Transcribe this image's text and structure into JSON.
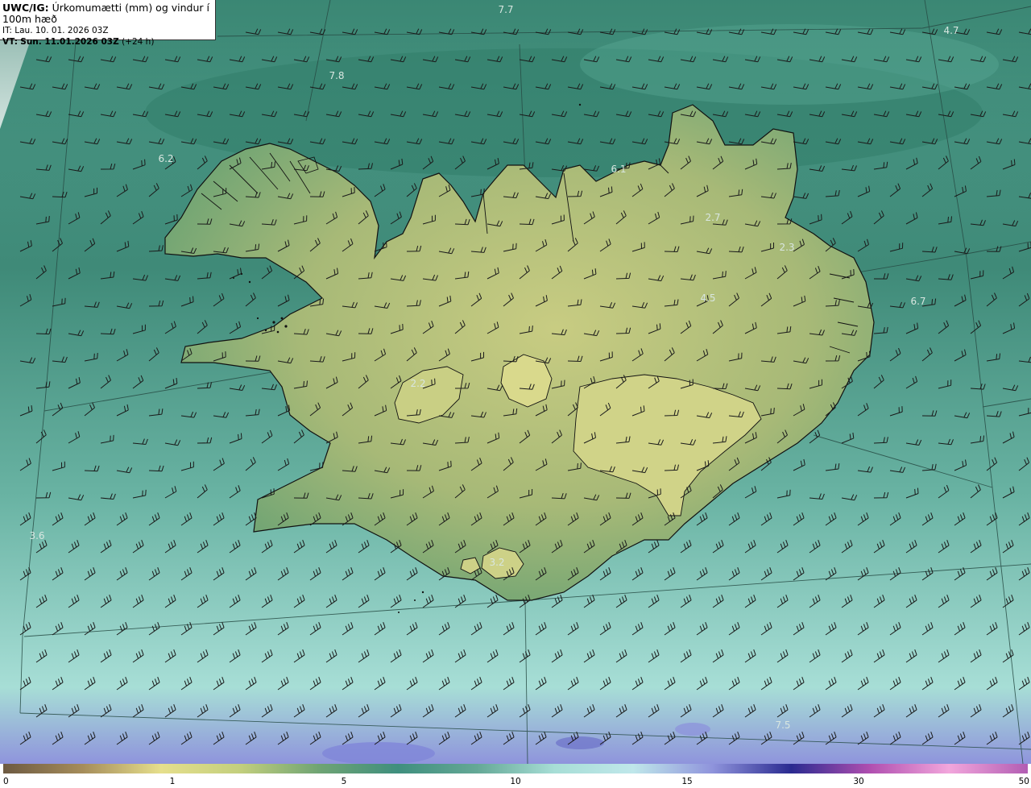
{
  "header": {
    "model": "UWC/IG:",
    "title": "Úrkomumætti (mm) og vindur í 100m hæð",
    "init_prefix": "IT:",
    "init_time": "Lau. 10. 01. 2026 03Z",
    "valid_prefix": "VT:",
    "valid_time": "Sun. 11.01.2026 03Z",
    "lead": "(+24 h)"
  },
  "colorbar": {
    "ticks": [
      "0",
      "1",
      "5",
      "10",
      "15",
      "30",
      "50"
    ],
    "colors": [
      "#6d5a42",
      "#a58c5a",
      "#e6df8c",
      "#c3cf7d",
      "#6fa474",
      "#3f8f7e",
      "#64a896",
      "#a7ded6",
      "#bfe7ea",
      "#8f94dc",
      "#2a2a90",
      "#b04fb0",
      "#f2a6dc",
      "#b25db3"
    ]
  },
  "map_values": [
    "7.7",
    "4.7",
    "7.8",
    "6.2",
    "6.1",
    "2.7",
    "2.3",
    "4.5",
    "6.7",
    "2.2",
    "3.6",
    "3.2",
    "7.5"
  ],
  "palette": {
    "sea": "#58a894",
    "land": "#d6d487",
    "coast": "#111111"
  }
}
